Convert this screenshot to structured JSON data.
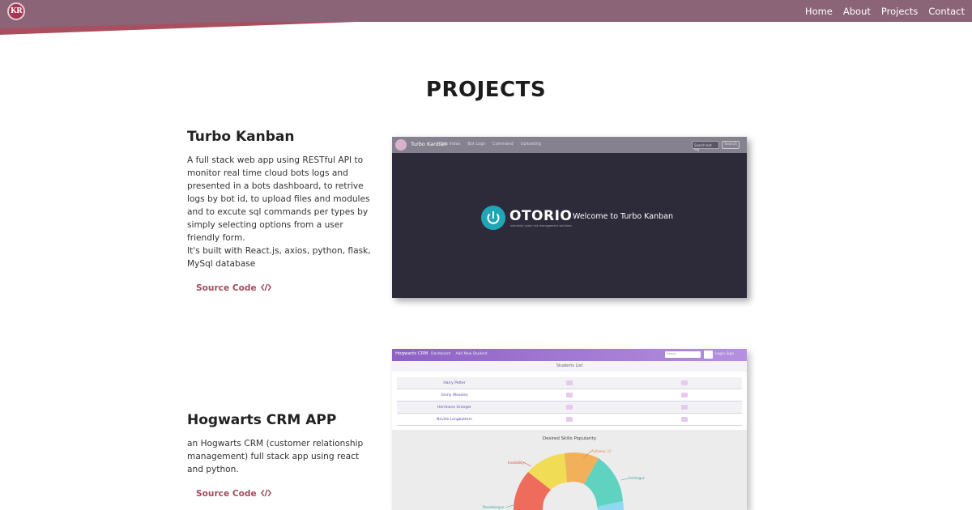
{
  "nav": {
    "logo": "KR",
    "links": [
      "Home",
      "About",
      "Projects",
      "Contact"
    ]
  },
  "page_title": "PROJECTS",
  "projects": [
    {
      "title": "Turbo Kanban",
      "description_lines": [
        "A full stack web app using RESTful API to",
        "monitor real time cloud bots logs and",
        "presented in a bots dashboard, to retrive",
        "logs by bot id, to upload files and modules",
        "and to excute sql commands per types by",
        "simply selecting options from a user",
        "friendly form.",
        "It's built with React.js, axios, python, flask,",
        "MySql database"
      ],
      "source_label": "Source Code",
      "preview": {
        "brand": "Turbo Kanban",
        "nav_items": [
          "Bots Index",
          "Bot Logs",
          "Command",
          "Uploading"
        ],
        "search_placeholder": "Search bot log",
        "search_button": "Search",
        "logo_word": "OTORIO",
        "logo_tagline": "industrial cyber risk management solutions",
        "welcome": "Welcome to Turbo Kanban"
      }
    },
    {
      "title": "Hogwarts CRM APP",
      "description_lines": [
        "an Hogwarts CRM (customer relationship",
        "management) full stack app using react",
        "and python."
      ],
      "source_label": "Source Code",
      "preview": {
        "brand": "Hogwarts CRM",
        "nav_items": [
          "Dashboard",
          "Add New Student"
        ],
        "search_placeholder": "Search",
        "right_items": [
          "Login",
          "Sign"
        ],
        "subheader": "Students List",
        "students": [
          "Harry Potter",
          "Ginny Weasley",
          "Hermione Granger",
          "Neville Longbottom"
        ],
        "chart_title": "Desired Skills Popularity",
        "chart_labels": [
          "Alchemy: 12",
          "Invisibility",
          "Animagus",
          "Parseltongue"
        ]
      }
    }
  ]
}
